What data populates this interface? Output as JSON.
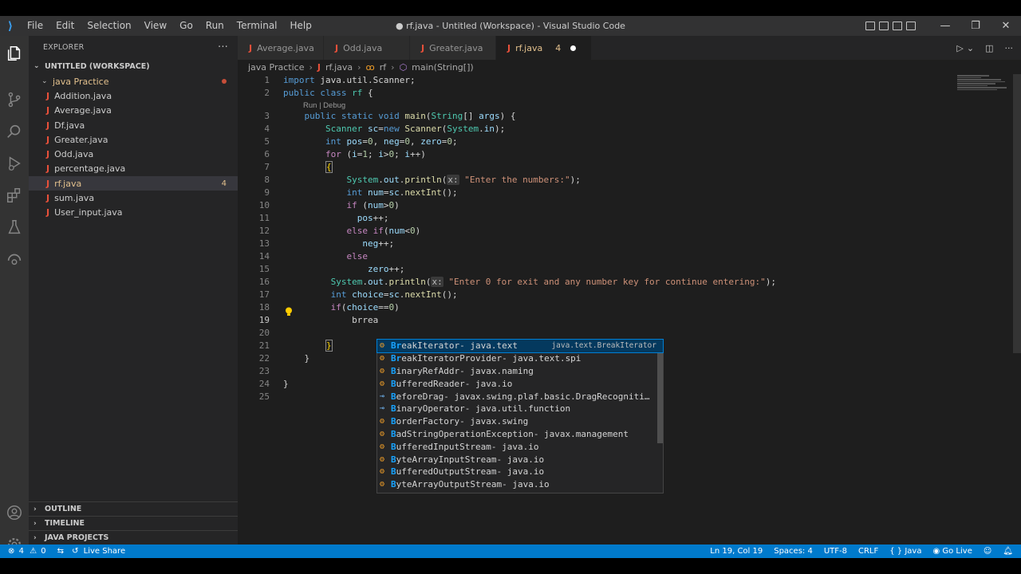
{
  "window": {
    "title": "● rf.java - Untitled (Workspace) - Visual Studio Code",
    "menu": [
      "File",
      "Edit",
      "Selection",
      "View",
      "Go",
      "Run",
      "Terminal",
      "Help"
    ]
  },
  "sidebar": {
    "header": "EXPLORER",
    "workspace": "UNTITLED (WORKSPACE)",
    "folder": "java Practice",
    "files": [
      {
        "name": "Addition.java"
      },
      {
        "name": "Average.java"
      },
      {
        "name": "Df.java"
      },
      {
        "name": "Greater.java"
      },
      {
        "name": "Odd.java"
      },
      {
        "name": "percentage.java"
      },
      {
        "name": "rf.java",
        "badge": "4"
      },
      {
        "name": "sum.java"
      },
      {
        "name": "User_input.java"
      }
    ],
    "bottom_sections": [
      "OUTLINE",
      "TIMELINE",
      "JAVA PROJECTS"
    ]
  },
  "tabs": [
    {
      "label": "Average.java"
    },
    {
      "label": "Odd.java"
    },
    {
      "label": "Greater.java"
    },
    {
      "label": "rf.java",
      "problems": "4"
    }
  ],
  "breadcrumb": [
    "java Practice",
    "rf.java",
    "rf",
    "main(String[])"
  ],
  "editor": {
    "codelens": "Run | Debug",
    "line_numbers": [
      "1",
      "2",
      "3",
      "4",
      "5",
      "6",
      "7",
      "8",
      "9",
      "10",
      "11",
      "12",
      "13",
      "14",
      "15",
      "16",
      "17",
      "18",
      "19",
      "20",
      "21",
      "22",
      "23",
      "24",
      "25"
    ],
    "current_line": "19"
  },
  "suggestions": {
    "selected_detail": "java.text.BreakIterator",
    "items": [
      {
        "match": "Br",
        "rest": "eakIterator",
        "pkg": " - java.text",
        "kind": "class"
      },
      {
        "match": "Br",
        "rest": "eakIteratorProvider",
        "pkg": " - java.text.spi",
        "kind": "class"
      },
      {
        "match": "B",
        "rest": "inaryRefAddr",
        "pkg": " - javax.naming",
        "kind": "class"
      },
      {
        "match": "B",
        "rest": "ufferedReader",
        "pkg": " - java.io",
        "kind": "class"
      },
      {
        "match": "B",
        "rest": "eforeDrag",
        "pkg": " - javax.swing.plaf.basic.DragRecogniti…",
        "kind": "interface"
      },
      {
        "match": "B",
        "rest": "inaryOperator",
        "pkg": " - java.util.function",
        "kind": "interface"
      },
      {
        "match": "B",
        "rest": "orderFactory",
        "pkg": " - javax.swing",
        "kind": "class"
      },
      {
        "match": "B",
        "rest": "adStringOperationException",
        "pkg": " - javax.management",
        "kind": "class"
      },
      {
        "match": "B",
        "rest": "ufferedInputStream",
        "pkg": " - java.io",
        "kind": "class"
      },
      {
        "match": "B",
        "rest": "yteArrayInputStream",
        "pkg": " - java.io",
        "kind": "class"
      },
      {
        "match": "B",
        "rest": "ufferedOutputStream",
        "pkg": " - java.io",
        "kind": "class"
      },
      {
        "match": "B",
        "rest": "yteArrayOutputStream",
        "pkg": " - java.io",
        "kind": "class"
      }
    ]
  },
  "statusbar": {
    "errors": "4",
    "warnings": "0",
    "live_share": "Live Share",
    "position": "Ln 19, Col 19",
    "spaces": "Spaces: 4",
    "encoding": "UTF-8",
    "eol": "CRLF",
    "language": "Java",
    "go_live": "Go Live"
  },
  "colors": {
    "accent": "#007acc",
    "modified": "#e2c08d",
    "java_icon": "#e8503a"
  }
}
